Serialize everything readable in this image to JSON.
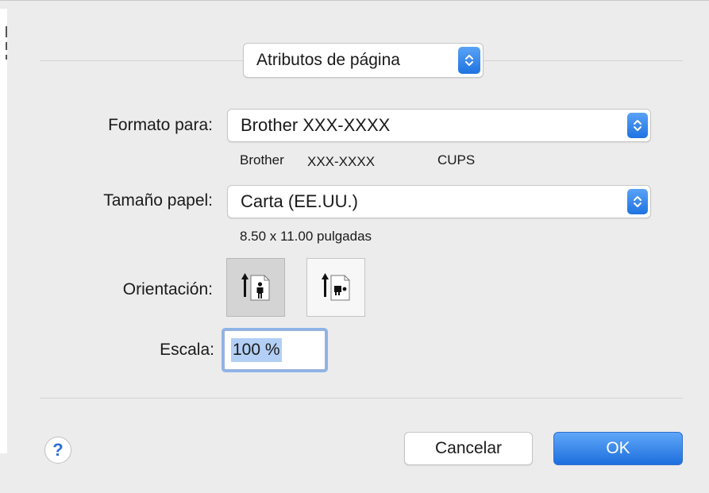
{
  "settings_popup": {
    "value": "Atributos de página"
  },
  "format_for": {
    "label": "Formato para:",
    "value": "Brother XXX-XXXX",
    "printer_name": "Brother",
    "printer_model": "XXX-XXXX",
    "driver": "CUPS"
  },
  "paper_size": {
    "label": "Tamaño papel:",
    "value": "Carta (EE.UU.)",
    "dimensions": "8.50 x 11.00 pulgadas"
  },
  "orientation": {
    "label": "Orientación:",
    "options": [
      "portrait",
      "landscape"
    ],
    "selected": "portrait",
    "portrait_icon": "portrait-person-icon",
    "landscape_icon": "landscape-person-icon"
  },
  "scale": {
    "label": "Escala:",
    "value": "100 %"
  },
  "buttons": {
    "help": "?",
    "cancel": "Cancelar",
    "ok": "OK"
  },
  "colors": {
    "accent": "#1e74e0",
    "background": "#ececec",
    "selection": "#b3cff5"
  }
}
